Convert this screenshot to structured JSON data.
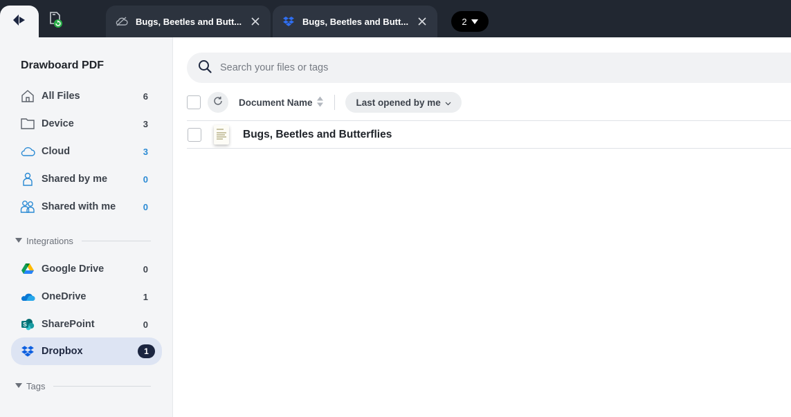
{
  "tabs": {
    "home_icon": "drawboard-logo-icon",
    "sync_icon": "file-sync-icon",
    "items": [
      {
        "title": "Bugs, Beetles and Butt...",
        "icon": "cloud-off-icon"
      },
      {
        "title": "Bugs, Beetles and Butt...",
        "icon": "dropbox-icon"
      }
    ],
    "counter": "2"
  },
  "sidebar": {
    "brand": "Drawboard PDF",
    "items": [
      {
        "label": "All Files",
        "count": "6",
        "icon": "home-icon"
      },
      {
        "label": "Device",
        "count": "3",
        "icon": "folder-icon"
      },
      {
        "label": "Cloud",
        "count": "3",
        "icon": "cloud-icon"
      },
      {
        "label": "Shared by me",
        "count": "0",
        "icon": "person-icon"
      },
      {
        "label": "Shared with me",
        "count": "0",
        "icon": "people-icon"
      }
    ],
    "integrations_label": "Integrations",
    "integrations": [
      {
        "label": "Google Drive",
        "count": "0",
        "icon": "google-drive-icon"
      },
      {
        "label": "OneDrive",
        "count": "1",
        "icon": "onedrive-icon"
      },
      {
        "label": "SharePoint",
        "count": "0",
        "icon": "sharepoint-icon"
      },
      {
        "label": "Dropbox",
        "count": "1",
        "icon": "dropbox-icon",
        "active": true
      }
    ],
    "tags_label": "Tags"
  },
  "main": {
    "search_placeholder": "Search your files or tags",
    "columns": {
      "document_name": "Document Name",
      "filter": "Last opened by me"
    },
    "files": [
      {
        "name": "Bugs, Beetles and Butterflies"
      }
    ]
  },
  "colors": {
    "topbar": "#212731",
    "sidebar": "#f4f5f7",
    "active_item": "#dde4f3",
    "accent_blue": "#2a8ad4",
    "badge_dark": "#1b2540"
  }
}
